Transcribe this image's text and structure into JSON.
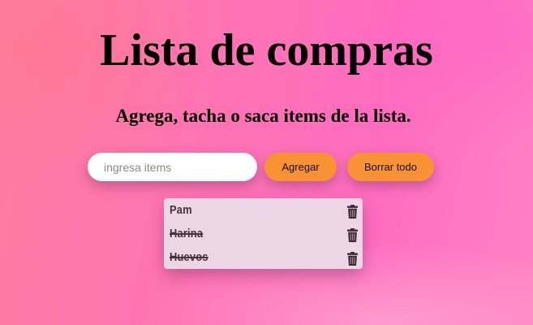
{
  "header": {
    "title": "Lista de compras",
    "subtitle": "Agrega, tacha o saca items de la lista."
  },
  "form": {
    "input_placeholder": "ingresa items",
    "input_value": "",
    "add_label": "Agregar",
    "clear_label": "Borrar todo"
  },
  "list": {
    "items": [
      {
        "label": "Pam",
        "crossed_out": false
      },
      {
        "label": "Harina",
        "crossed_out": true
      },
      {
        "label": "Huevos",
        "crossed_out": true
      }
    ]
  },
  "icons": {
    "delete_icon": "trash-icon"
  },
  "colors": {
    "accent_button": "#f99234",
    "list_background": "#ecdee8",
    "item_text": "#46323c"
  }
}
